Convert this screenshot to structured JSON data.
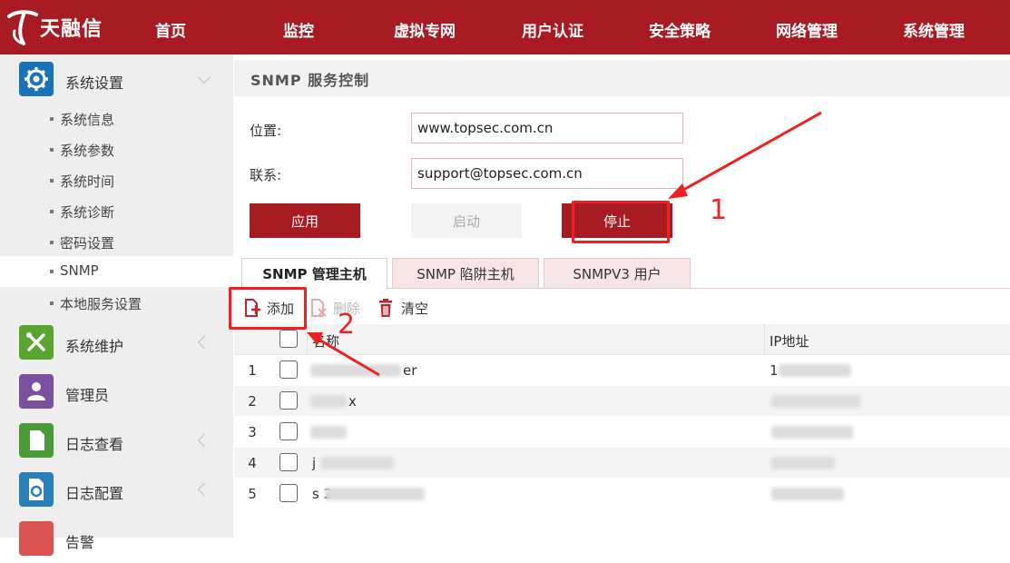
{
  "brand": {
    "name": "天融信"
  },
  "nav": [
    "首页",
    "监控",
    "虚拟专网",
    "用户认证",
    "安全策略",
    "网络管理",
    "系统管理"
  ],
  "sidebar": {
    "group_system_settings": "系统设置",
    "sub_items": [
      "系统信息",
      "系统参数",
      "系统时间",
      "系统诊断",
      "密码设置",
      "SNMP",
      "本地服务设置"
    ],
    "groups": [
      "系统维护",
      "管理员",
      "日志查看",
      "日志配置",
      "告警"
    ]
  },
  "panel": {
    "title": "SNMP 服务控制",
    "location_label": "位置:",
    "location_value": "www.topsec.com.cn",
    "contact_label": "联系:",
    "contact_value": "support@topsec.com.cn",
    "apply_label": "应用",
    "start_label": "启动",
    "stop_label": "停止"
  },
  "tabs": [
    "SNMP 管理主机",
    "SNMP 陷阱主机",
    "SNMPV3 用户"
  ],
  "toolbar": {
    "add": "添加",
    "delete": "删除",
    "clear": "清空"
  },
  "table": {
    "columns": [
      "名称",
      "IP地址"
    ],
    "rows": [
      {
        "num": "1",
        "name": "er",
        "ip": "1"
      },
      {
        "num": "2",
        "name": "x",
        "ip": ""
      },
      {
        "num": "3",
        "name": "",
        "ip": ""
      },
      {
        "num": "4",
        "name": "j",
        "ip": ""
      },
      {
        "num": "5",
        "name": "s 2",
        "ip": ""
      }
    ]
  },
  "annotations": {
    "step1": "1",
    "step2": "2"
  },
  "colors": {
    "brand_red": "#a91b22",
    "annotation_red": "#ee2222"
  }
}
